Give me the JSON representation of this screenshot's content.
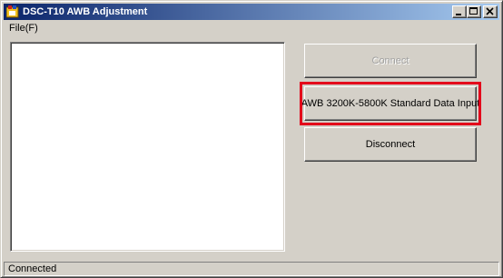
{
  "window": {
    "title": "DSC-T10 AWB Adjustment"
  },
  "titlebar": {
    "icons": {
      "app": "app-icon",
      "minimize": "minimize-icon",
      "maximize": "maximize-icon",
      "close": "close-icon"
    }
  },
  "menu": {
    "items": [
      {
        "label": "File(F)"
      }
    ]
  },
  "buttons": {
    "connect": {
      "label": "Connect",
      "enabled": false
    },
    "awb_input": {
      "label": "AWB 3200K-5800K Standard Data Input",
      "highlighted": true
    },
    "disconnect": {
      "label": "Disconnect"
    }
  },
  "status": {
    "text": "Connected"
  },
  "colors": {
    "titlebar_start": "#0a246a",
    "titlebar_end": "#a6caf0",
    "highlight": "#e3001b",
    "face": "#d4d0c8"
  }
}
